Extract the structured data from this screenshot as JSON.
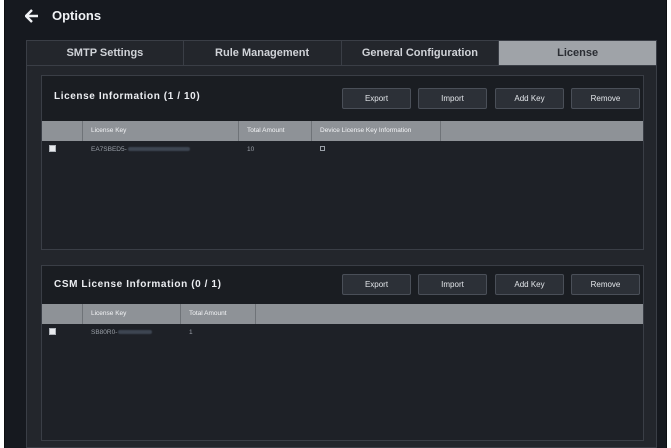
{
  "window": {
    "title": "Options"
  },
  "tabs": [
    {
      "label": "SMTP Settings"
    },
    {
      "label": "Rule Management"
    },
    {
      "label": "General Configuration"
    },
    {
      "label": "License"
    }
  ],
  "license_panel": {
    "title": "License Information (1 / 10)",
    "buttons": {
      "export": "Export",
      "import": "Import",
      "add_key": "Add Key",
      "remove": "Remove"
    },
    "columns": [
      "License Key",
      "Total Amount",
      "Device License Key Information"
    ],
    "rows": [
      {
        "license_key_prefix": "EA7SBED5-",
        "total_amount": "10"
      }
    ]
  },
  "csm_panel": {
    "title": "CSM License Information (0 / 1)",
    "buttons": {
      "export": "Export",
      "import": "Import",
      "add_key": "Add Key",
      "remove": "Remove"
    },
    "columns": [
      "License Key",
      "Total Amount"
    ],
    "rows": [
      {
        "license_key_prefix": "SB80R0-",
        "total_amount": "1"
      }
    ]
  },
  "colors": {
    "background": "#16191f",
    "panel": "#1e2127",
    "active_tab": "#9fa3a8",
    "table_header": "#8e9297"
  }
}
